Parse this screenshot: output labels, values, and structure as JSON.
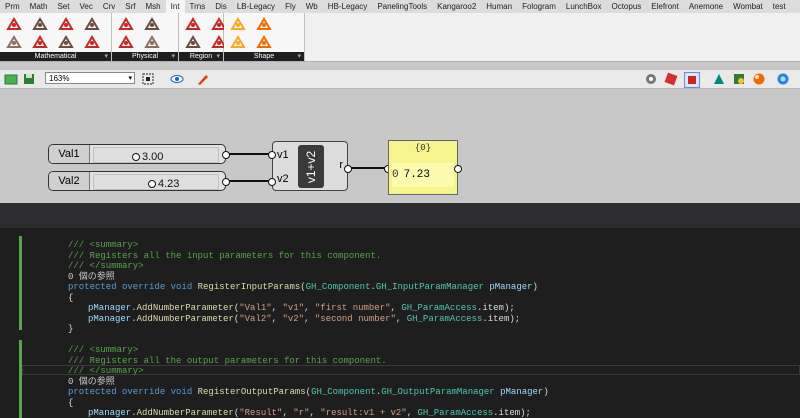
{
  "tabs": [
    "Prm",
    "Math",
    "Set",
    "Vec",
    "Crv",
    "Srf",
    "Msh",
    "Int",
    "Trns",
    "Dis",
    "LB-Legacy",
    "Fly",
    "Wb",
    "HB-Legacy",
    "PanelingTools",
    "Kangaroo2",
    "Human",
    "Fologram",
    "LunchBox",
    "Octopus",
    "Elefront",
    "Anemone",
    "Wombat",
    "test"
  ],
  "active_tab_index": 7,
  "ribbon": {
    "groups": [
      {
        "label": "Mathematical"
      },
      {
        "label": "Physical"
      },
      {
        "label": "Region"
      },
      {
        "label": "Shape"
      }
    ],
    "expander": "▾"
  },
  "toolbar": {
    "zoom": "163%",
    "dropdown_glyph": "▾"
  },
  "canvas": {
    "sliders": [
      {
        "name": "Val1",
        "value": "3.00",
        "fraction": 0.3
      },
      {
        "name": "Val2",
        "value": "4.23",
        "fraction": 0.42
      }
    ],
    "component": {
      "inputs": [
        "v1",
        "v2"
      ],
      "label": "v1+v2",
      "output": "r"
    },
    "panel": {
      "header": "{0}",
      "index": "0",
      "value": "7.23"
    }
  },
  "code": {
    "colors": {
      "comment": "#57a64a",
      "keyword": "#569cd6",
      "type": "#4ec9b0",
      "string": "#d69d85",
      "method": "#dcdcaa"
    },
    "lines": [
      {
        "indent": 1,
        "parts": [
          [
            "cm",
            "/// <summary>"
          ]
        ]
      },
      {
        "indent": 1,
        "parts": [
          [
            "cm",
            "/// Registers all the input parameters for this component."
          ]
        ]
      },
      {
        "indent": 1,
        "parts": [
          [
            "cm",
            "/// </summary>"
          ]
        ]
      },
      {
        "indent": 1,
        "parts": [
          [
            "ref",
            "0 個の参照"
          ]
        ]
      },
      {
        "indent": 1,
        "parts": [
          [
            "kw",
            "protected override void "
          ],
          [
            "fn",
            "RegisterInputParams"
          ],
          [
            "tx",
            "("
          ],
          [
            "ty",
            "GH_Component"
          ],
          [
            "tx",
            "."
          ],
          [
            "ty",
            "GH_InputParamManager"
          ],
          [
            "tx",
            " "
          ],
          [
            "pm",
            "pManager"
          ],
          [
            "tx",
            ")"
          ]
        ]
      },
      {
        "indent": 1,
        "parts": [
          [
            "tx",
            "{"
          ]
        ]
      },
      {
        "indent": 2,
        "parts": [
          [
            "pm",
            "pManager"
          ],
          [
            "tx",
            "."
          ],
          [
            "fn",
            "AddNumberParameter"
          ],
          [
            "tx",
            "("
          ],
          [
            "st",
            "\"Val1\""
          ],
          [
            "tx",
            ", "
          ],
          [
            "st",
            "\"v1\""
          ],
          [
            "tx",
            ", "
          ],
          [
            "st",
            "\"first number\""
          ],
          [
            "tx",
            ", "
          ],
          [
            "ty",
            "GH_ParamAccess"
          ],
          [
            "tx",
            ".item);"
          ]
        ]
      },
      {
        "indent": 2,
        "parts": [
          [
            "pm",
            "pManager"
          ],
          [
            "tx",
            "."
          ],
          [
            "fn",
            "AddNumberParameter"
          ],
          [
            "tx",
            "("
          ],
          [
            "st",
            "\"Val2\""
          ],
          [
            "tx",
            ", "
          ],
          [
            "st",
            "\"v2\""
          ],
          [
            "tx",
            ", "
          ],
          [
            "st",
            "\"second number\""
          ],
          [
            "tx",
            ", "
          ],
          [
            "ty",
            "GH_ParamAccess"
          ],
          [
            "tx",
            ".item);"
          ]
        ]
      },
      {
        "indent": 1,
        "parts": [
          [
            "tx",
            "}"
          ]
        ]
      },
      {
        "indent": 1,
        "parts": [
          [
            "tx",
            ""
          ]
        ]
      },
      {
        "indent": 1,
        "parts": [
          [
            "cm",
            "/// <summary>"
          ]
        ]
      },
      {
        "indent": 1,
        "parts": [
          [
            "cm",
            "/// Registers all the output parameters for this component."
          ]
        ]
      },
      {
        "indent": 1,
        "parts": [
          [
            "cm",
            "/// </summary>"
          ]
        ]
      },
      {
        "indent": 1,
        "parts": [
          [
            "ref",
            "0 個の参照"
          ]
        ]
      },
      {
        "indent": 1,
        "parts": [
          [
            "kw",
            "protected override void "
          ],
          [
            "fn",
            "RegisterOutputParams"
          ],
          [
            "tx",
            "("
          ],
          [
            "ty",
            "GH_Component"
          ],
          [
            "tx",
            "."
          ],
          [
            "ty",
            "GH_OutputParamManager"
          ],
          [
            "tx",
            " "
          ],
          [
            "pm",
            "pManager"
          ],
          [
            "tx",
            ")"
          ]
        ]
      },
      {
        "indent": 1,
        "parts": [
          [
            "tx",
            "{"
          ]
        ]
      },
      {
        "indent": 2,
        "parts": [
          [
            "pm",
            "pManager"
          ],
          [
            "tx",
            "."
          ],
          [
            "fn",
            "AddNumberParameter"
          ],
          [
            "tx",
            "("
          ],
          [
            "st",
            "\"Result\""
          ],
          [
            "tx",
            ", "
          ],
          [
            "st",
            "\"r\""
          ],
          [
            "tx",
            ", "
          ],
          [
            "st",
            "\"result:v1 + v2\""
          ],
          [
            "tx",
            ", "
          ],
          [
            "ty",
            "GH_ParamAccess"
          ],
          [
            "tx",
            ".item);"
          ]
        ]
      }
    ]
  }
}
